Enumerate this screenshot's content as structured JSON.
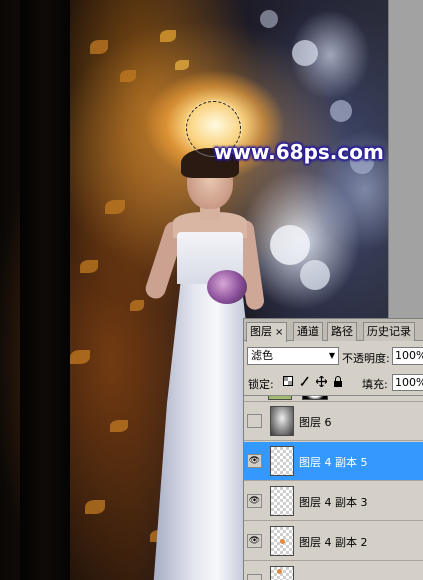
{
  "watermark": "www.68ps.com",
  "layers_panel": {
    "tabs": [
      {
        "label": "图层",
        "close": "×",
        "active": true
      },
      {
        "label": "通道",
        "active": false
      },
      {
        "label": "路径",
        "active": false
      },
      {
        "label": "历史记录",
        "active": false
      }
    ],
    "blend_mode": "滤色",
    "opacity_label": "不透明度:",
    "opacity_value": "100%",
    "lock_label": "锁定:",
    "fill_label": "填充:",
    "fill_value": "100%",
    "layers": [
      {
        "name": "图层 6",
        "visible": false,
        "selected": false
      },
      {
        "name": "图层 4 副本 5",
        "visible": true,
        "selected": true
      },
      {
        "name": "图层 4 副本 3",
        "visible": false,
        "selected": false
      },
      {
        "name": "图层 4 副本 2",
        "visible": true,
        "selected": false
      }
    ]
  },
  "colors": {
    "selected_layer": "#3399ff",
    "panel_bg": "#d4d0c8",
    "watermark_outline": "#2a1d9a"
  },
  "icons": [
    "eye-icon",
    "lock-transparency-icon",
    "lock-paint-icon",
    "lock-move-icon",
    "lock-all-icon",
    "dropdown-arrow-icon",
    "close-icon"
  ]
}
